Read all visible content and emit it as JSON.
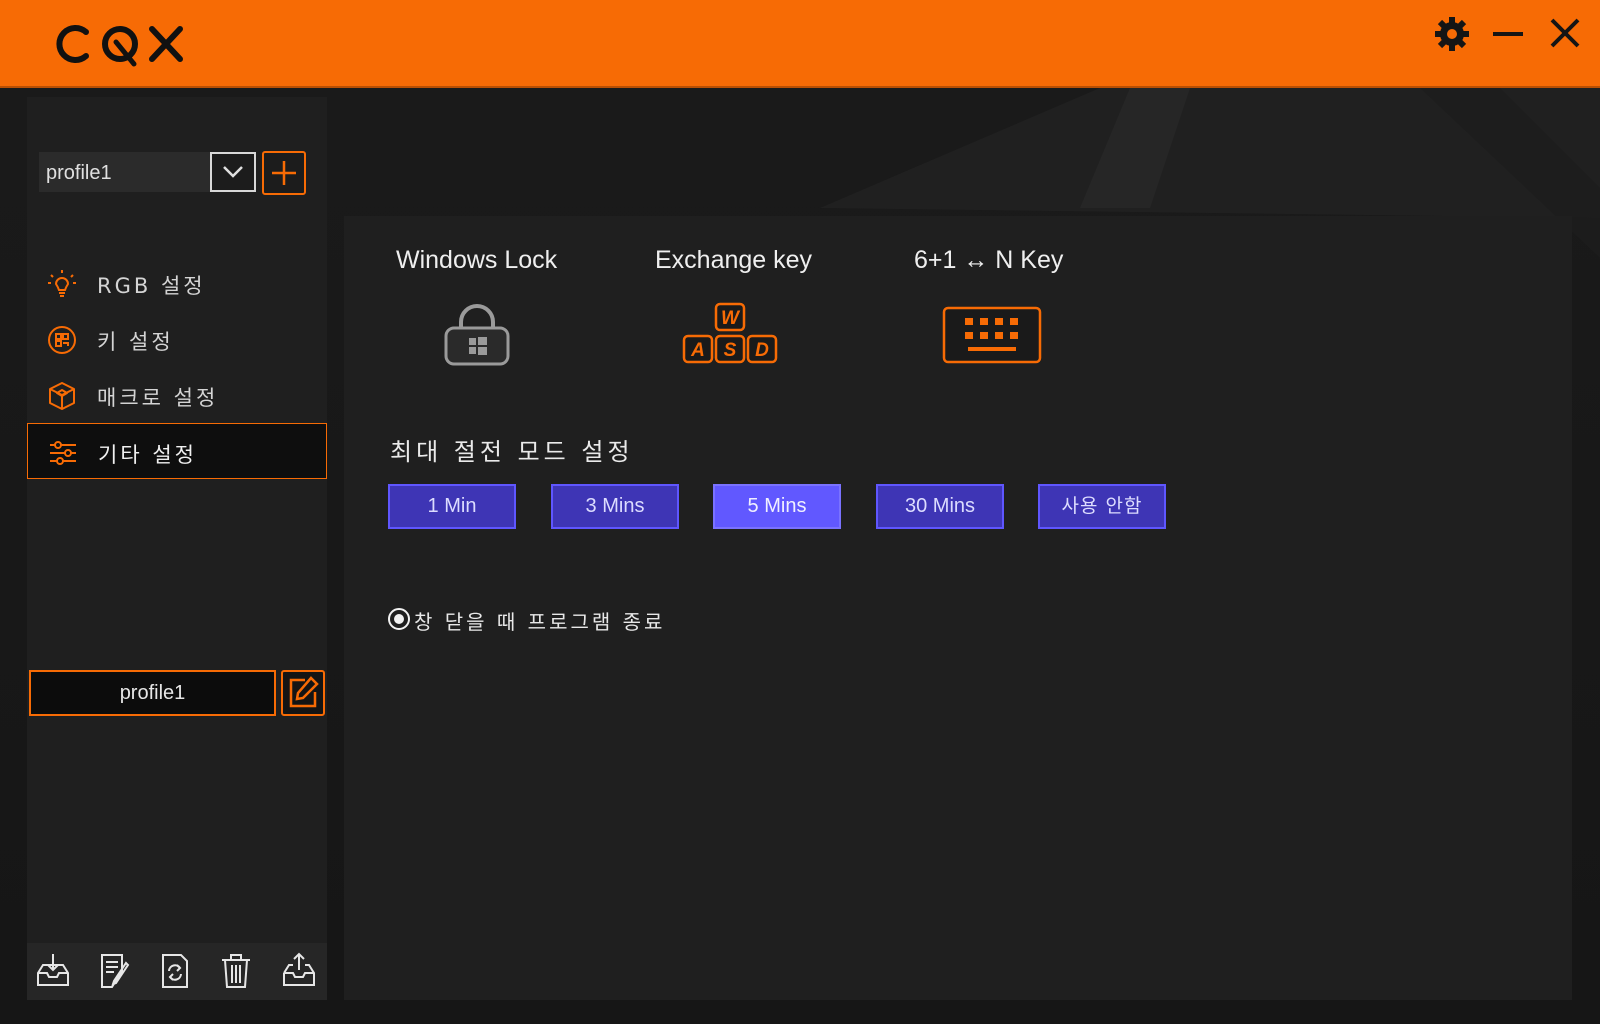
{
  "app": {
    "logo_text": "COX",
    "accent_color": "#f76b05",
    "window_controls": [
      "gear-icon",
      "minimize-icon",
      "close-icon"
    ]
  },
  "sidebar": {
    "profile_select_value": "profile1",
    "menu": [
      {
        "label": "RGB 설정",
        "icon": "bulb-icon",
        "active": false
      },
      {
        "label": "키 설정",
        "icon": "keys-icon",
        "active": false
      },
      {
        "label": "매크로 설정",
        "icon": "cube-icon",
        "active": false
      },
      {
        "label": "기타 설정",
        "icon": "sliders-icon",
        "active": true
      }
    ],
    "profile_name": "profile1",
    "toolbar_icons": [
      "import-icon",
      "document-icon",
      "refresh-icon",
      "trash-icon",
      "export-icon"
    ]
  },
  "panel": {
    "features": [
      {
        "label": "Windows Lock",
        "icon": "windows-lock-icon",
        "enabled": false
      },
      {
        "label": "Exchange key",
        "icon": "wasd-icon",
        "enabled": true
      },
      {
        "label": "6+1 ↔ N Key",
        "icon": "keyboard-icon",
        "enabled": true
      }
    ],
    "power_section_title": "최대 절전 모드 설정",
    "power_options": [
      "1 Min",
      "3 Mins",
      "5 Mins",
      "30 Mins",
      "사용 안함"
    ],
    "power_selected": "5 Mins",
    "exit_option_label": "창 닫을 때 프로그램 종료",
    "exit_option_checked": true,
    "button_color": "#3e35b5",
    "button_selected_color": "#6158ff"
  }
}
